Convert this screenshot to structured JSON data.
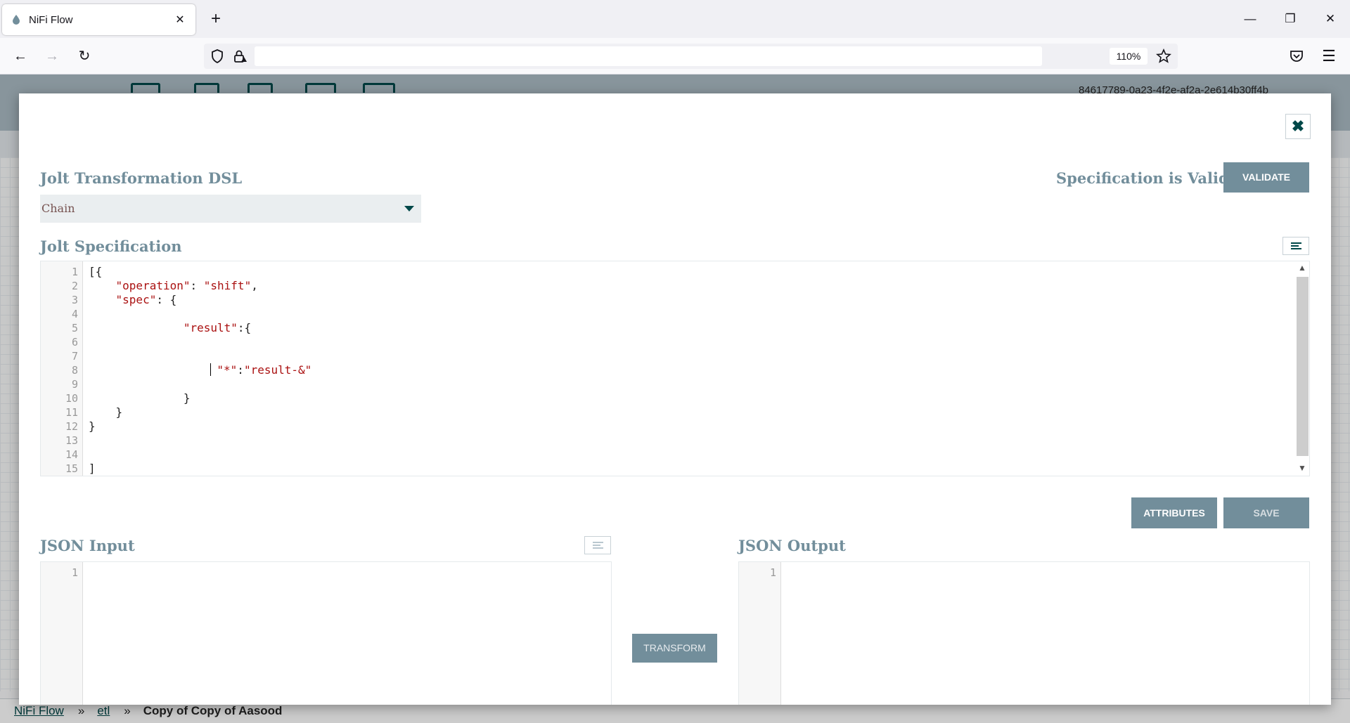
{
  "browser": {
    "tab_title": "NiFi Flow",
    "new_tab_label": "+",
    "zoom_level": "110%",
    "url": ""
  },
  "nifi": {
    "process_group_id": "84617789-0a23-4f2e-af2a-2e614b30ff4b",
    "breadcrumbs": [
      "NiFi Flow",
      "etl",
      "Copy of Copy of Aasood"
    ],
    "breadcrumb_separator": "»"
  },
  "dialog": {
    "dsl_title": "Jolt Transformation DSL",
    "dsl_selected": "Chain",
    "validation_status": "Specification is Valid",
    "validate_label": "VALIDATE",
    "spec_title": "Jolt Specification",
    "spec_lines": [
      [
        "[{",
        ""
      ],
      [
        "    \"operation\": \"shift\",",
        ""
      ],
      [
        "    \"spec\": {",
        ""
      ],
      [
        "",
        ""
      ],
      [
        "              \"result\":{",
        ""
      ],
      [
        "",
        ""
      ],
      [
        "",
        ""
      ],
      [
        "                  \"*\":\"result-&\"",
        "caret"
      ],
      [
        "",
        ""
      ],
      [
        "              }",
        ""
      ],
      [
        "    }",
        ""
      ],
      [
        "}",
        ""
      ],
      [
        "",
        ""
      ],
      [
        "",
        ""
      ],
      [
        "]",
        ""
      ]
    ],
    "attributes_label": "ATTRIBUTES",
    "save_label": "SAVE",
    "json_input_title": "JSON Input",
    "json_output_title": "JSON Output",
    "transform_label": "TRANSFORM",
    "input_line_numbers": [
      "1"
    ],
    "output_line_numbers": [
      "1"
    ]
  },
  "colors": {
    "nifi_teal": "#004849",
    "label_gray_blue": "#728e9b",
    "header_bg": "#aabbc3"
  }
}
